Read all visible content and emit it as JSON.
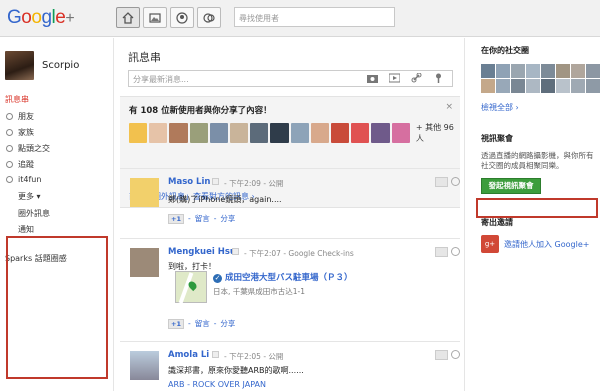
{
  "app": {
    "logo_text": "Google+",
    "search_placeholder": "尋找使用者"
  },
  "sidebar": {
    "user_name": "Scorpio",
    "stream_label": "訊息串",
    "circles": [
      "朋友",
      "家族",
      "點頭之交",
      "追蹤",
      "it4fun"
    ],
    "more_label": "更多",
    "extra": [
      "圈外訊息",
      "通知"
    ],
    "sparks_label": "Sparks 話題圈感"
  },
  "main": {
    "title": "訊息串",
    "share_placeholder": "分享最新消息...",
    "suggest": {
      "headline": "有 108 位新使用者與你分享了內容！",
      "others": "+ 其他 96 人",
      "link": "前往「圈外訊息」查看對方的訊息 ›",
      "close": "×"
    },
    "posts": [
      {
        "author": "Maso Lin",
        "time": "下午2:09",
        "visibility": "公開",
        "body": "鄭(購)了iPhone鏡頭，again....",
        "comment": "留言",
        "share": "分享",
        "plusone": "+1"
      },
      {
        "author": "Mengkuei Hsu",
        "time": "下午2:07",
        "source": "Google Check-ins",
        "body": "到啦，打卡！",
        "place": "成田空港大型バス駐車場（Ｐ３）",
        "address": "日本, 千葉県成田市古込1-1",
        "comment": "留言",
        "share": "分享",
        "plusone": "+1"
      },
      {
        "author": "Amola Li",
        "time": "下午2:05",
        "visibility": "公開",
        "body": "識深邦書，原來你愛聽ARB的歌啊......",
        "link_title": "ARB - ROCK OVER JAPAN"
      }
    ]
  },
  "right": {
    "circles_title": "在你的社交圈",
    "view_all": "檢視全部 ›",
    "hangout_title": "視訊聚會",
    "hangout_desc": "透過直播的網路攝影機，與你所有社交圈的成員相聚同樂。",
    "hangout_button": "發起視訊聚會",
    "invite_title": "寄出邀請",
    "invite_text": "邀請他人加入 Google+"
  },
  "colors": {
    "accent_blue": "#3366cc",
    "stream_red": "#d93025",
    "button_green": "#3c9d3c",
    "annotation_red": "#c0392b"
  }
}
